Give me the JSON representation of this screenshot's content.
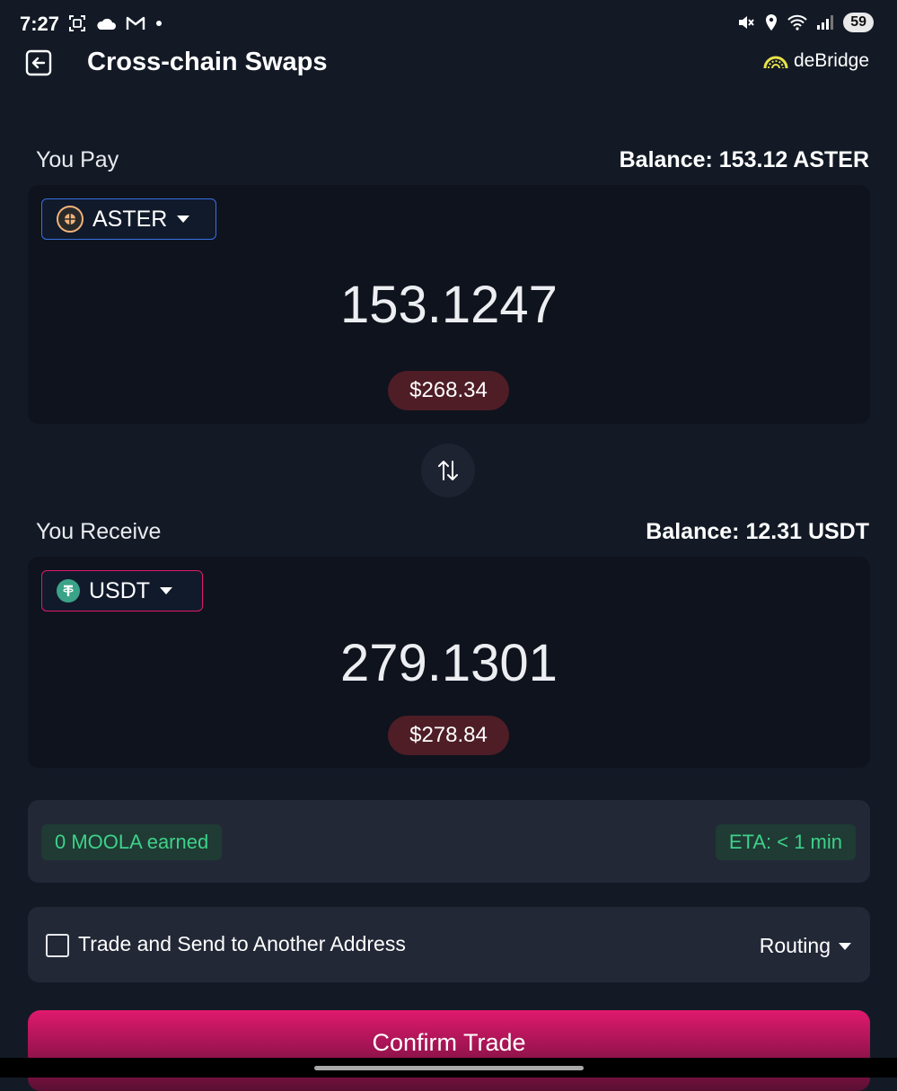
{
  "status_bar": {
    "time": "7:27",
    "battery": "59",
    "left_icons": [
      "screenshot-icon",
      "cloud-icon",
      "gmail-icon",
      "dot-icon"
    ],
    "right_icons": [
      "mute-icon",
      "location-icon",
      "wifi-icon",
      "signal-icon"
    ]
  },
  "header": {
    "title": "Cross-chain Swaps",
    "brand": "deBridge"
  },
  "pay": {
    "label": "You Pay",
    "balance": "Balance: 153.12 ASTER",
    "token": "ASTER",
    "amount": "153.1247",
    "usd": "$268.34",
    "border_color": "#3a6fe0"
  },
  "receive": {
    "label": "You Receive",
    "balance": "Balance: 12.31 USDT",
    "token": "USDT",
    "amount": "279.1301",
    "usd": "$278.84",
    "border_color": "#e0196e"
  },
  "info": {
    "earned": "0 MOOLA earned",
    "eta": "ETA: < 1 min"
  },
  "options": {
    "send_to_other": "Trade and Send to Another Address",
    "routing": "Routing"
  },
  "confirm_label": "Confirm Trade",
  "colors": {
    "background": "#131a26",
    "accent_pink": "#e0196e",
    "green": "#3ed18a"
  }
}
